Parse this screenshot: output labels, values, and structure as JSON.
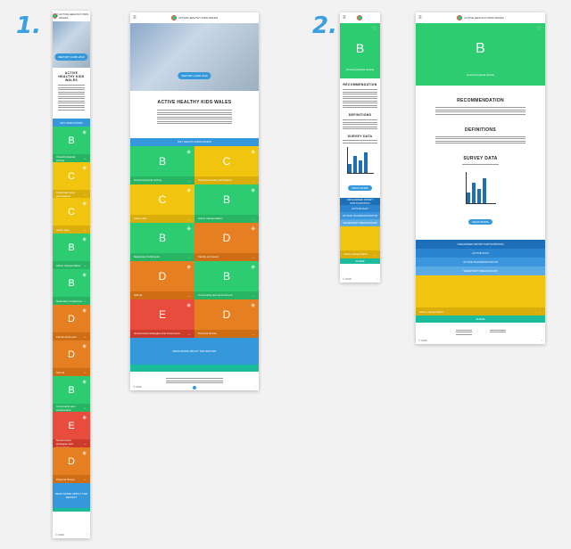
{
  "steps": [
    "1.",
    "2."
  ],
  "header": {
    "logo": "ACTIVE HEALTHY KIDS WALES"
  },
  "home": {
    "hero_button": "REPORT CARD 2016",
    "title": "ACTIVE HEALTHY KIDS WALES",
    "indicators_bar": "KEY INDICATORS",
    "indicators_bar_large": "KEY HEALTH INDICATORS",
    "tiles": [
      {
        "grade": "B",
        "label": "Overall physical activity",
        "color": "#2ecc71"
      },
      {
        "grade": "C",
        "label": "Organised sport participation",
        "color": "#f1c40f"
      },
      {
        "grade": "C",
        "label": "Active play",
        "color": "#f1c40f"
      },
      {
        "grade": "B",
        "label": "Active transportation",
        "color": "#2ecc71"
      },
      {
        "grade": "B",
        "label": "Sedentary behaviours",
        "color": "#2ecc71"
      },
      {
        "grade": "D",
        "label": "Family and peers",
        "color": "#e67e22"
      },
      {
        "grade": "D",
        "label": "School",
        "color": "#e67e22"
      },
      {
        "grade": "B",
        "label": "Community and environment",
        "color": "#2ecc71"
      },
      {
        "grade": "E",
        "label": "Government strategies and investment",
        "color": "#e74c3c"
      },
      {
        "grade": "D",
        "label": "Physical fitness",
        "color": "#e67e22"
      }
    ],
    "download": "READ MORE ABOUT THE REPORT",
    "footer_left": "© 2016",
    "footer_right": "↑"
  },
  "detail": {
    "grade": "B",
    "grade_label": "Overall physical activity",
    "recommendation": "RECOMMENDATION",
    "definitions": "DEFINITIONS",
    "survey": "SURVEY DATA",
    "survey_button": "READ MORE",
    "bars": [
      0.35,
      0.7,
      0.5,
      0.85
    ],
    "nav": [
      "ORGANISED SPORT PARTICIPATION",
      "ACTIVE PLAY",
      "ACTIVE TRANSPORTATION",
      "SEDENTARY BEHAVIOURS"
    ],
    "next_label": "Active transportation",
    "share": "SHARE"
  }
}
